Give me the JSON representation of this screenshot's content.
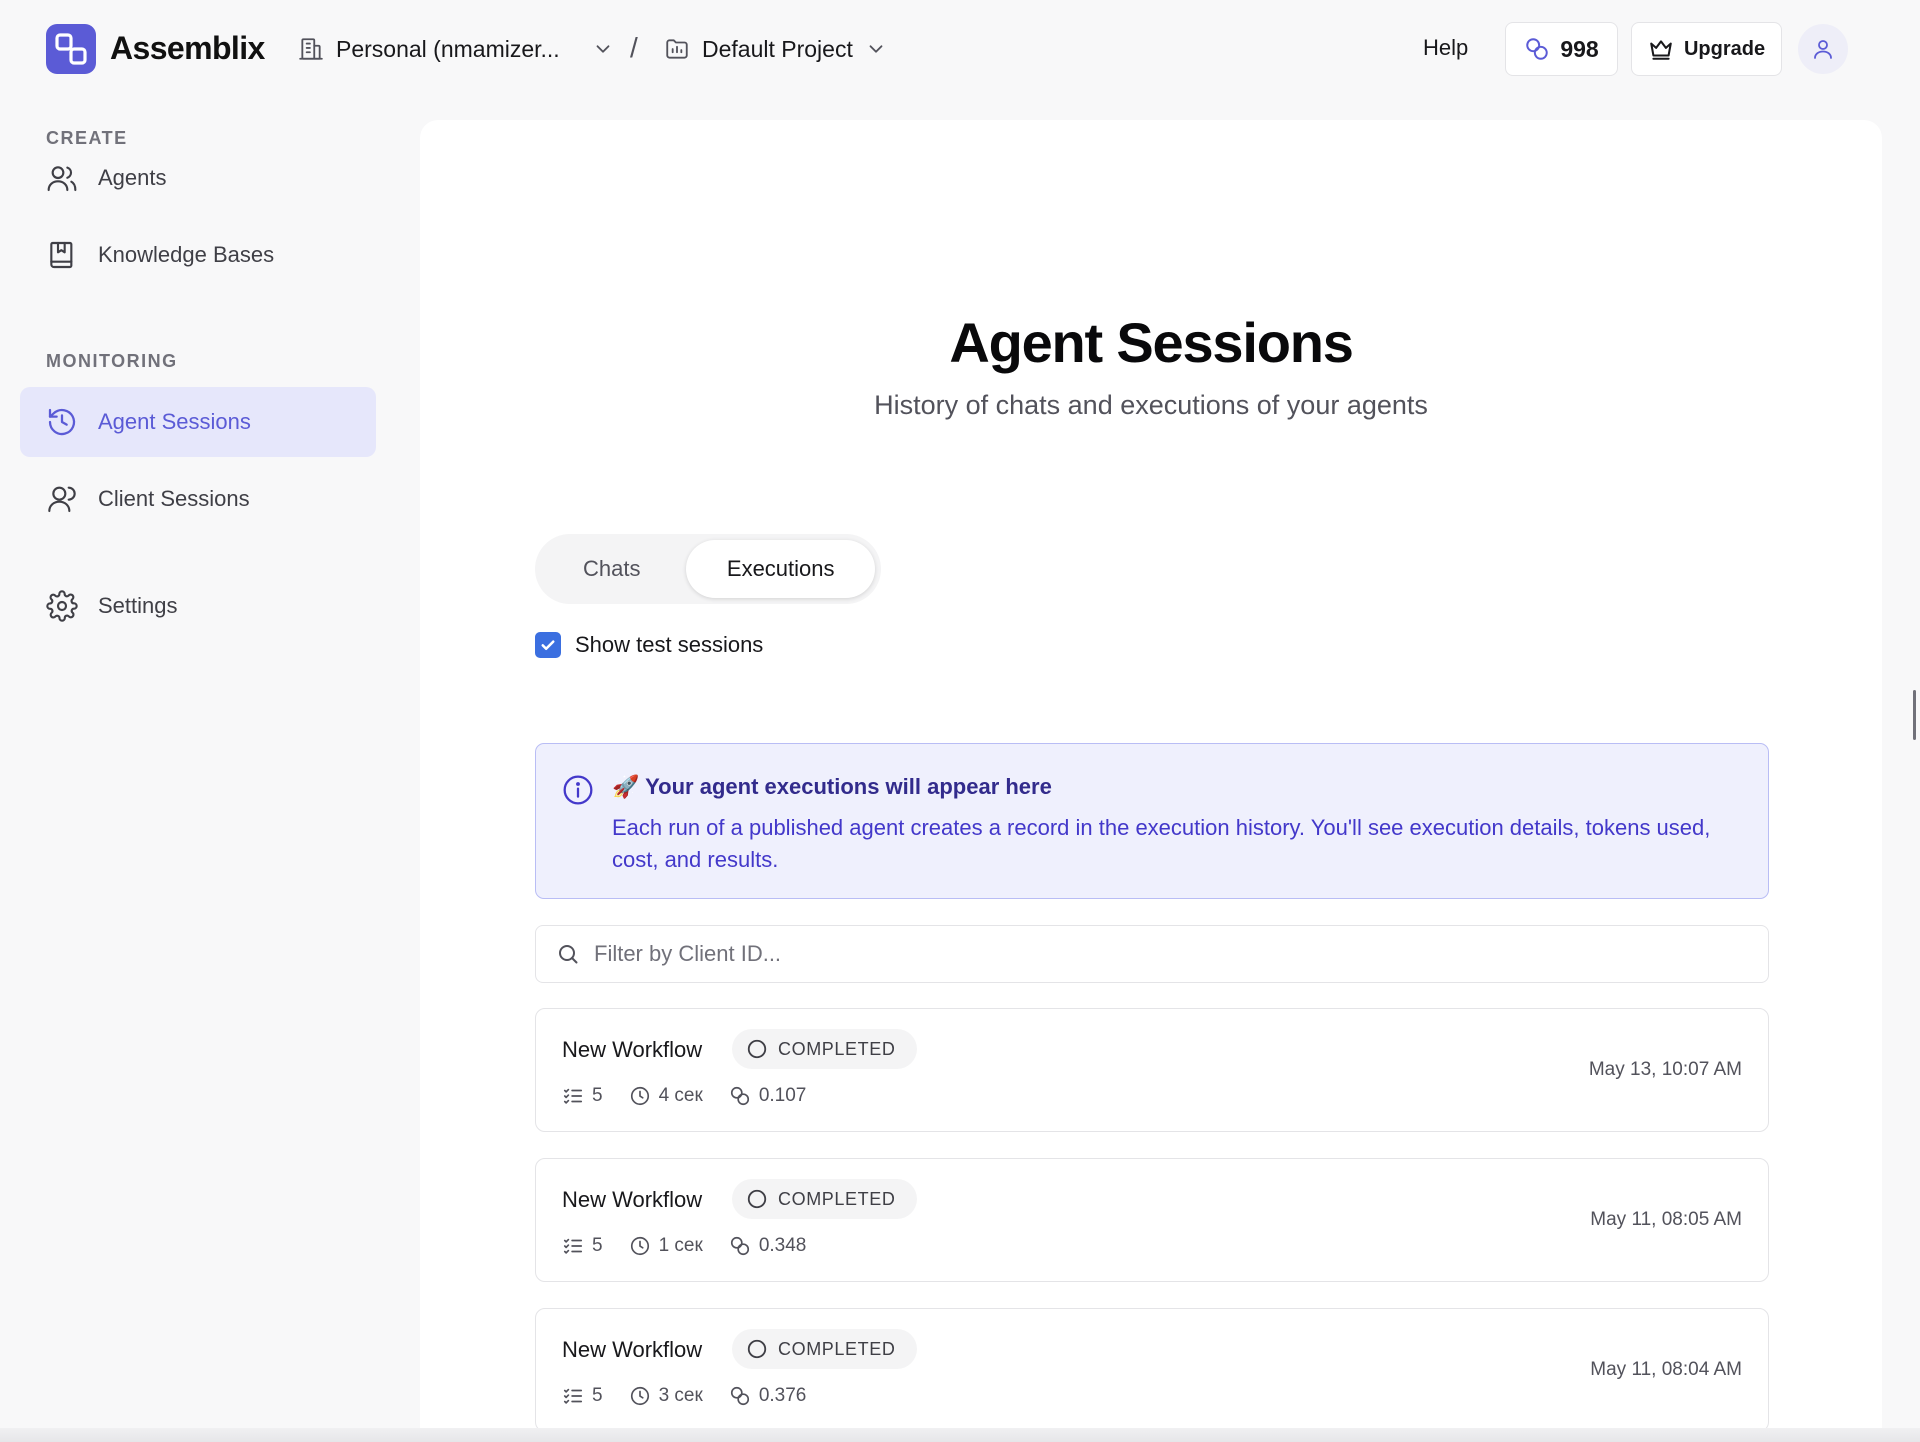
{
  "app": {
    "name": "Assemblix"
  },
  "header": {
    "org_name": "Personal (nmamizer...",
    "separator": "/",
    "project_name": "Default Project",
    "help_label": "Help",
    "credits": "998",
    "upgrade_label": "Upgrade"
  },
  "sidebar": {
    "create_label": "CREATE",
    "monitoring_label": "MONITORING",
    "items": [
      {
        "label": "Agents",
        "icon": "users-icon"
      },
      {
        "label": "Knowledge Bases",
        "icon": "book-icon"
      },
      {
        "label": "Agent Sessions",
        "icon": "history-icon",
        "active": true
      },
      {
        "label": "Client Sessions",
        "icon": "user-icon"
      },
      {
        "label": "Settings",
        "icon": "gear-icon"
      }
    ]
  },
  "page": {
    "title": "Agent Sessions",
    "subtitle": "History of chats and executions of your agents"
  },
  "tabs": [
    {
      "label": "Chats",
      "selected": false
    },
    {
      "label": "Executions",
      "selected": true
    }
  ],
  "filters": {
    "show_test_label": "Show test sessions",
    "show_test_checked": true,
    "search_placeholder": "Filter by Client ID..."
  },
  "info": {
    "emoji": "🚀",
    "title": "Your agent executions will appear here",
    "body": "Each run of a published agent creates a record in the execution history. You'll see execution details, tokens used, cost, and results."
  },
  "sessions": [
    {
      "name": "New Workflow",
      "status": "COMPLETED",
      "steps": "5",
      "duration": "4 сек",
      "cost": "0.107",
      "date": "May 13, 10:07 AM"
    },
    {
      "name": "New Workflow",
      "status": "COMPLETED",
      "steps": "5",
      "duration": "1 сек",
      "cost": "0.348",
      "date": "May 11, 08:05 AM"
    },
    {
      "name": "New Workflow",
      "status": "COMPLETED",
      "steps": "5",
      "duration": "3 сек",
      "cost": "0.376",
      "date": "May 11, 08:04 AM"
    }
  ],
  "colors": {
    "accent": "#5b5bd6",
    "active_nav_bg": "#e6e7fb",
    "info_bg": "#eff0fd",
    "info_text": "#4338ca",
    "checkbox": "#3b6fe0"
  }
}
